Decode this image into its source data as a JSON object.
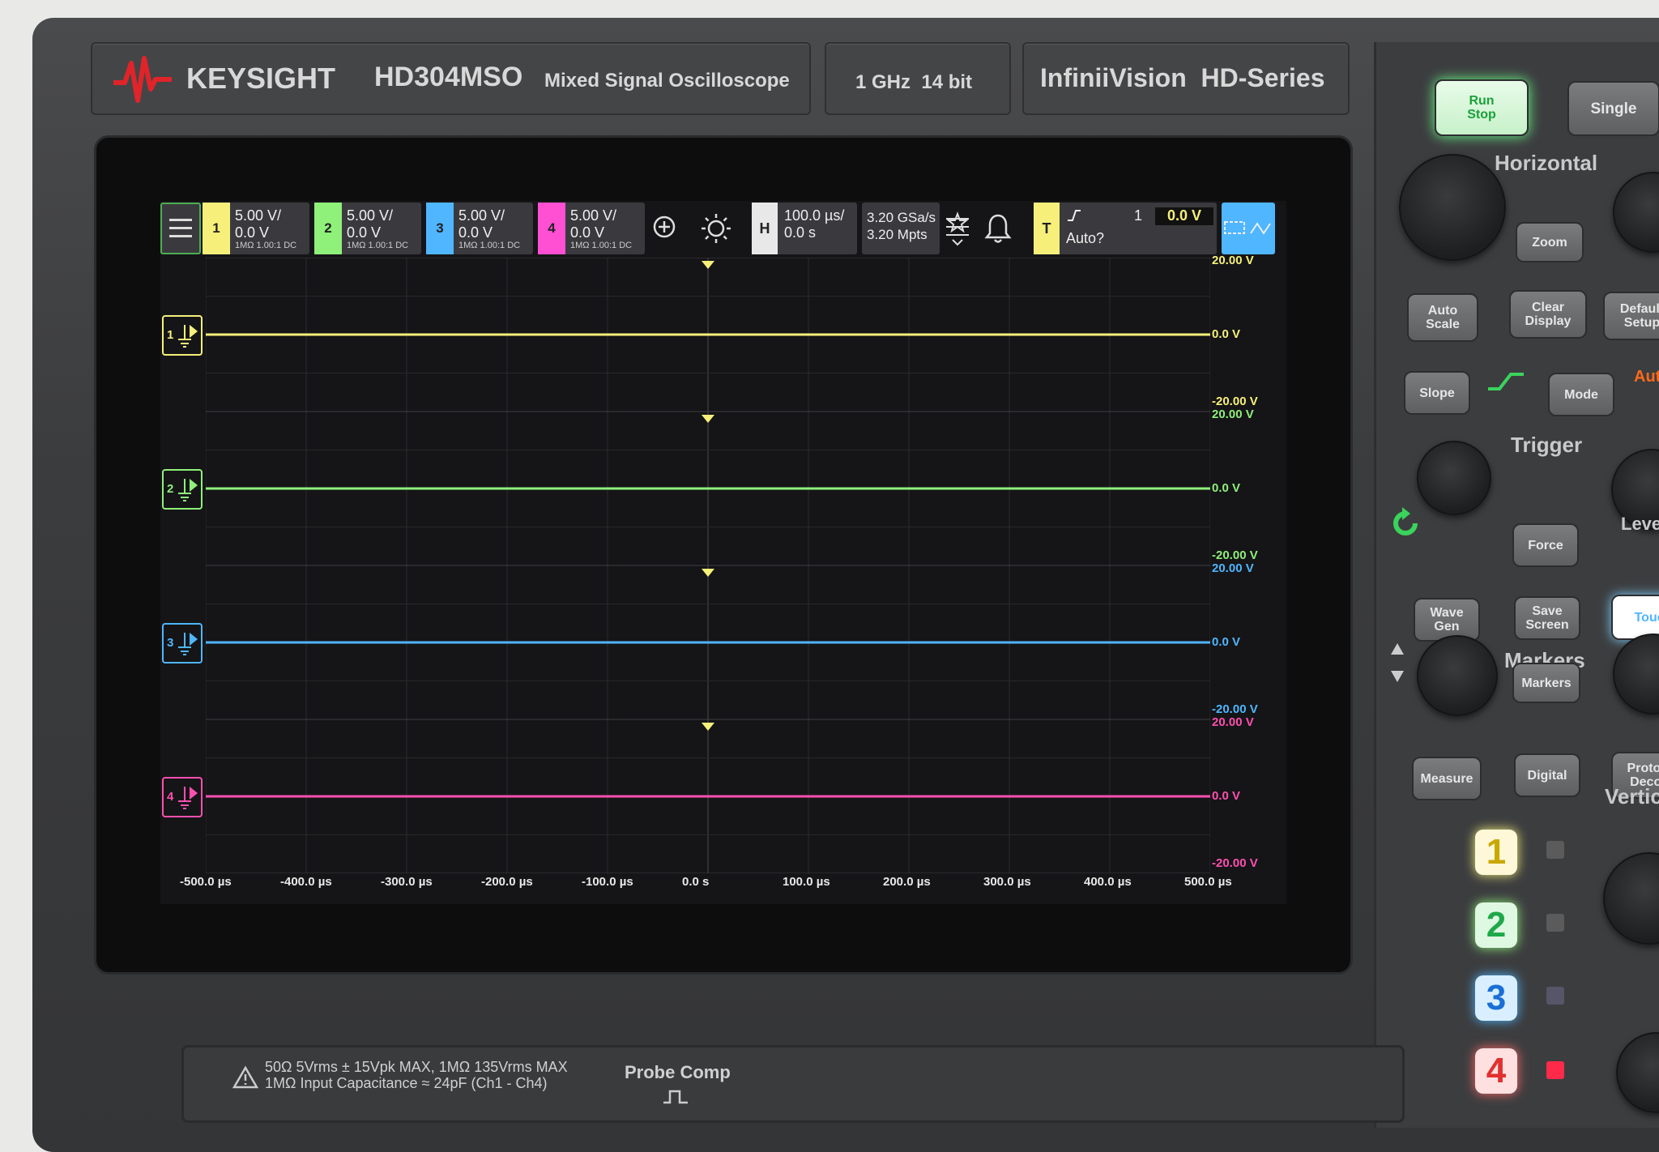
{
  "brand": {
    "company": "KEYSIGHT",
    "model": "HD304MSO",
    "model_desc": "Mixed Signal Oscilloscope",
    "spec": "1 GHz  14 bit",
    "series": "InfiniiVision  HD-Series"
  },
  "colors": {
    "ch1": "#f6f07a",
    "ch2": "#8ff07a",
    "ch3": "#4fb6ff",
    "ch4": "#ff4fb0",
    "trigger": "#f6f07a"
  },
  "channels": [
    {
      "num": "1",
      "scale": "5.00 V/",
      "offset": "0.0 V",
      "sub": "1MΩ  1.00:1  DC"
    },
    {
      "num": "2",
      "scale": "5.00 V/",
      "offset": "0.0 V",
      "sub": "1MΩ  1.00:1  DC"
    },
    {
      "num": "3",
      "scale": "5.00 V/",
      "offset": "0.0 V",
      "sub": "1MΩ  1.00:1  DC"
    },
    {
      "num": "4",
      "scale": "5.00 V/",
      "offset": "0.0 V",
      "sub": "1MΩ  1.00:1  DC"
    }
  ],
  "horizontal": {
    "label": "H",
    "scale": "100.0 µs/",
    "delay": "0.0 s"
  },
  "acquisition": {
    "rate": "3.20 GSa/s",
    "depth": "3.20 Mpts"
  },
  "trigger": {
    "label": "T",
    "source": "1",
    "level": "0.0 V",
    "mode": "Auto?"
  },
  "traces": [
    {
      "name": "1",
      "top": "20.00 V",
      "mid": "0.0 V",
      "bottom": "-20.00 V",
      "level": 0
    },
    {
      "name": "2",
      "top": "20.00 V",
      "mid": "0.0 V",
      "bottom": "-20.00 V",
      "level": 0
    },
    {
      "name": "3",
      "top": "20.00 V",
      "mid": "0.0 V",
      "bottom": "-20.00 V",
      "level": 0
    },
    {
      "name": "4",
      "top": "20.00 V",
      "mid": "0.0 V",
      "bottom": "-20.00 V",
      "level": 0
    }
  ],
  "time_axis": [
    "-500.0 µs",
    "-400.0 µs",
    "-300.0 µs",
    "-200.0 µs",
    "-100.0 µs",
    "0.0 s",
    "100.0 µs",
    "200.0 µs",
    "300.0 µs",
    "400.0 µs",
    "500.0 µs"
  ],
  "panel": {
    "run_stop": "Run\nStop",
    "single": "Single",
    "horizontal": "Horizontal",
    "zoom": "Zoom",
    "auto_scale": "Auto\nScale",
    "clear_display": "Clear\nDisplay",
    "default_setup": "Default\nSetup",
    "slope": "Slope",
    "mode": "Mode",
    "auto": "Auto",
    "trigger": "Trigger",
    "force": "Force",
    "level": "Level",
    "wave_gen": "Wave\nGen",
    "save_screen": "Save\nScreen",
    "touch": "Touch",
    "markers_title": "Markers",
    "markers": "Markers",
    "measure": "Measure",
    "digital": "Digital",
    "protocol_decode": "Protocol\nDecode",
    "vertical": "Vertical",
    "ch_buttons": [
      "1",
      "2",
      "3",
      "4"
    ]
  },
  "bottom": {
    "warning_line1": "50Ω 5Vrms ± 15Vpk MAX, 1MΩ 135Vrms MAX",
    "warning_line2": "1MΩ Input Capacitance ≈ 24pF (Ch1 - Ch4)",
    "probe_comp": "Probe Comp"
  }
}
